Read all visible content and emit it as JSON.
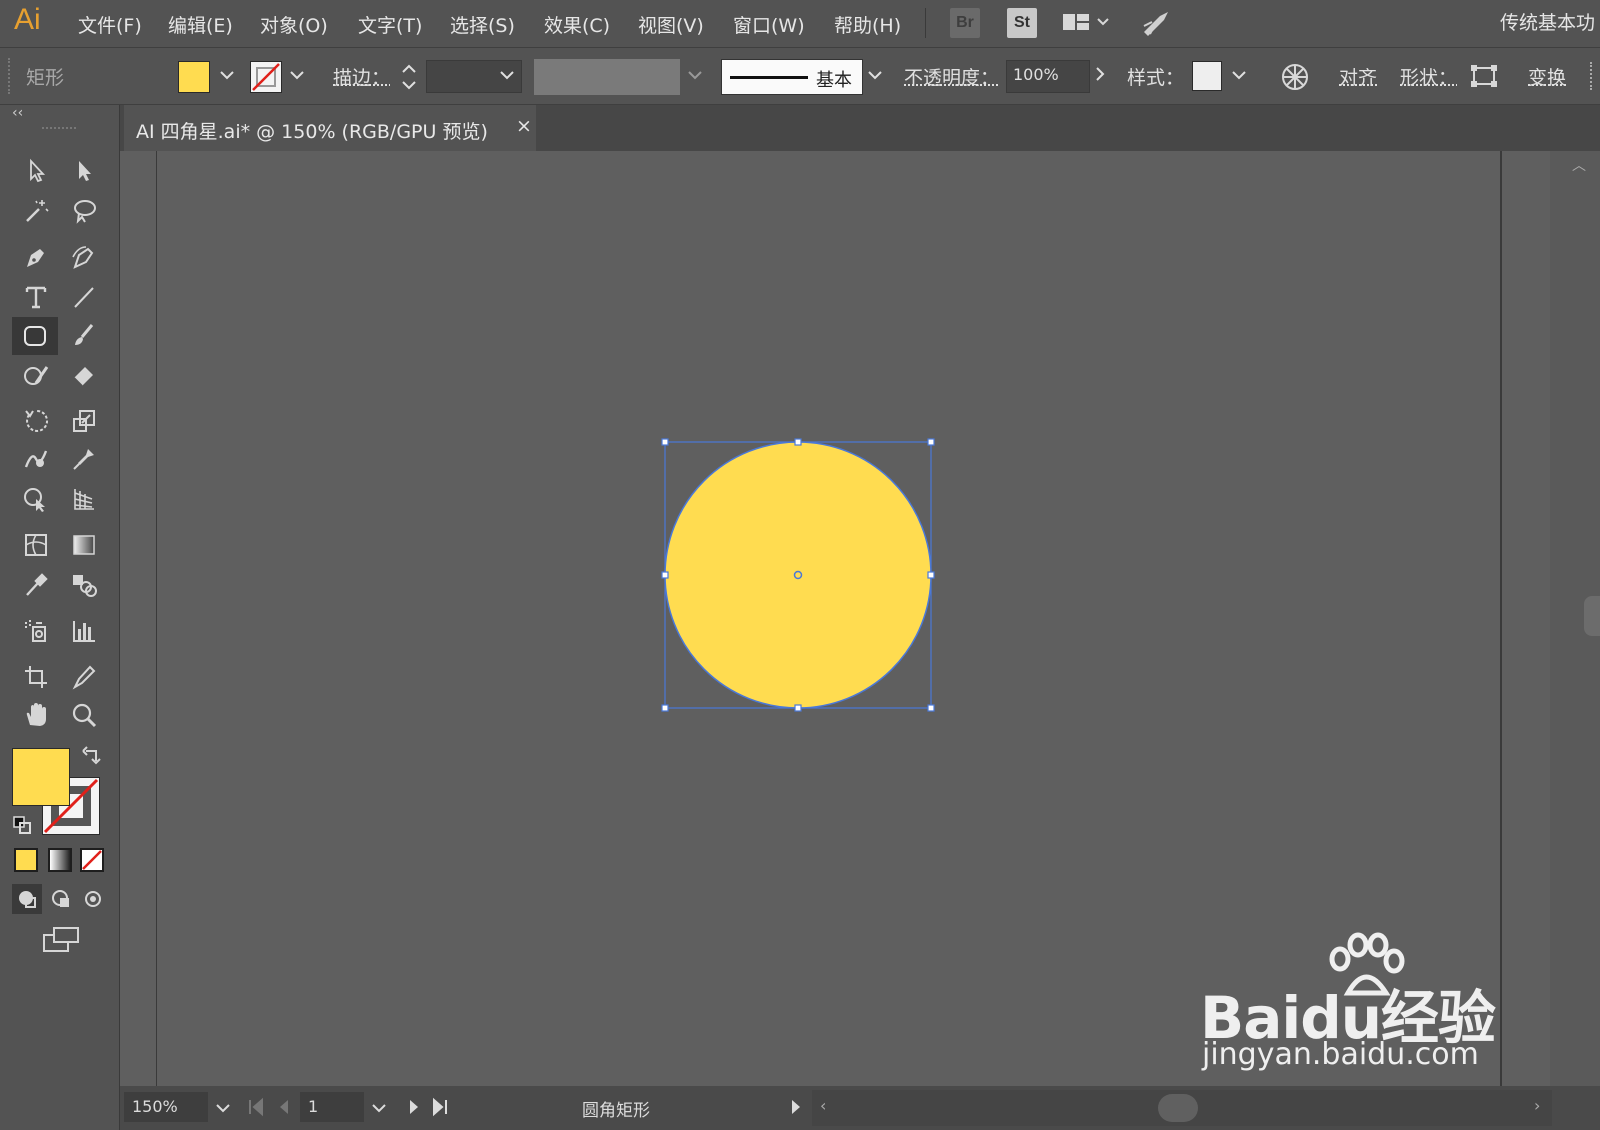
{
  "app": {
    "logo": "Ai",
    "workspace": "传统基本功"
  },
  "menu": [
    "文件(F)",
    "编辑(E)",
    "对象(O)",
    "文字(T)",
    "选择(S)",
    "效果(C)",
    "视图(V)",
    "窗口(W)",
    "帮助(H)"
  ],
  "menu_icons": {
    "bridge": "Br",
    "stock": "St"
  },
  "control": {
    "object_type": "矩形",
    "fill_color": "#ffdc50",
    "stroke_label": "描边：",
    "stroke_profile": "基本",
    "opacity_label": "不透明度：",
    "opacity_value": "100%",
    "style_label": "样式：",
    "align_label": "对齐",
    "shape_label": "形状：",
    "transform_label": "变换"
  },
  "document": {
    "tab_title": "AI 四角星.ai* @ 150% (RGB/GPU 预览)",
    "close": "×"
  },
  "colors": {
    "fill": "#ffdc50",
    "selection": "#4a78d8"
  },
  "status": {
    "zoom": "150%",
    "page": "1",
    "tool_name": "圆角矩形"
  },
  "watermark": {
    "brand": "Baidu经验",
    "url": "jingyan.baidu.com"
  }
}
